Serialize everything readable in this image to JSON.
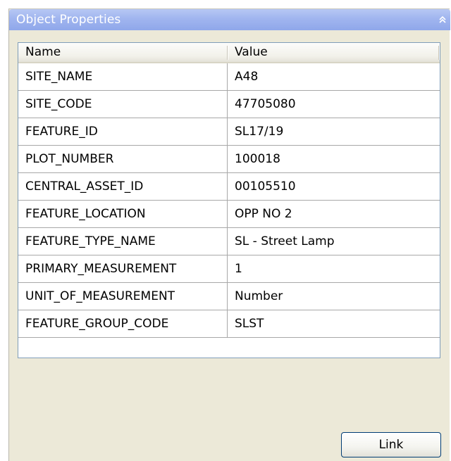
{
  "panel": {
    "title": "Object Properties",
    "collapse_icon": "double-chevron-up-icon"
  },
  "grid": {
    "columns": [
      "Name",
      "Value"
    ],
    "rows": [
      {
        "name": "SITE_NAME",
        "value": "A48"
      },
      {
        "name": "SITE_CODE",
        "value": "47705080"
      },
      {
        "name": "FEATURE_ID",
        "value": "SL17/19"
      },
      {
        "name": "PLOT_NUMBER",
        "value": "100018"
      },
      {
        "name": "CENTRAL_ASSET_ID",
        "value": "00105510"
      },
      {
        "name": "FEATURE_LOCATION",
        "value": "OPP NO 2"
      },
      {
        "name": "FEATURE_TYPE_NAME",
        "value": "SL - Street Lamp"
      },
      {
        "name": "PRIMARY_MEASUREMENT",
        "value": "1"
      },
      {
        "name": "UNIT_OF_MEASUREMENT",
        "value": "Number"
      },
      {
        "name": "FEATURE_GROUP_CODE",
        "value": "SLST"
      }
    ]
  },
  "actions": {
    "link_label": "Link"
  },
  "colors": {
    "titlebar": "#a0b5ef",
    "panel_bg": "#ece9d8",
    "grid_border": "#7f9db9",
    "button_border": "#003c74"
  }
}
